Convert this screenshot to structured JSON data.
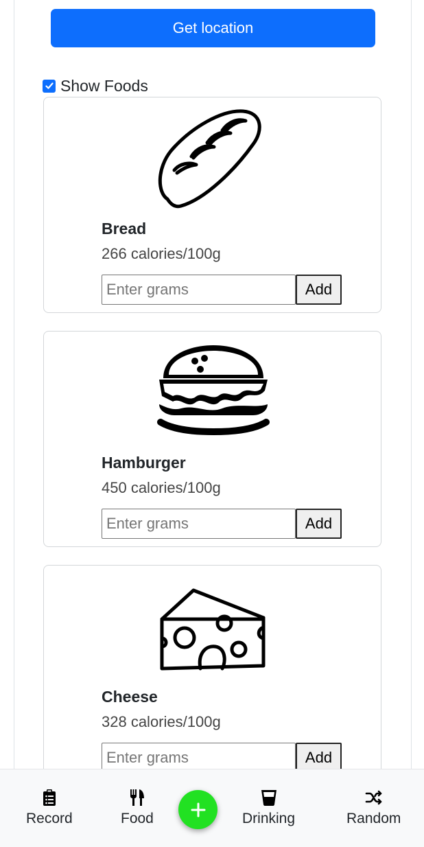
{
  "location": {
    "button_label": "Get location"
  },
  "filter": {
    "show_foods_label": "Show Foods",
    "show_foods_checked": true
  },
  "foods": [
    {
      "name": "Bread",
      "calories": "266 calories/100g",
      "icon": "bread-icon",
      "placeholder": "Enter grams",
      "add_label": "Add"
    },
    {
      "name": "Hamburger",
      "calories": "450 calories/100g",
      "icon": "hamburger-icon",
      "placeholder": "Enter grams",
      "add_label": "Add"
    },
    {
      "name": "Cheese",
      "calories": "328 calories/100g",
      "icon": "cheese-icon",
      "placeholder": "Enter grams",
      "add_label": "Add"
    }
  ],
  "nav": {
    "record": {
      "label": "Record",
      "icon": "clipboard-icon"
    },
    "food": {
      "label": "Food",
      "icon": "fork-knife-icon"
    },
    "add": {
      "icon": "plus-icon"
    },
    "drinking": {
      "label": "Drinking",
      "icon": "glass-icon"
    },
    "random": {
      "label": "Random",
      "icon": "shuffle-icon"
    }
  },
  "colors": {
    "primary": "#0d6efd",
    "fab": "#22e122",
    "nav_bg": "#f8f9fa"
  }
}
